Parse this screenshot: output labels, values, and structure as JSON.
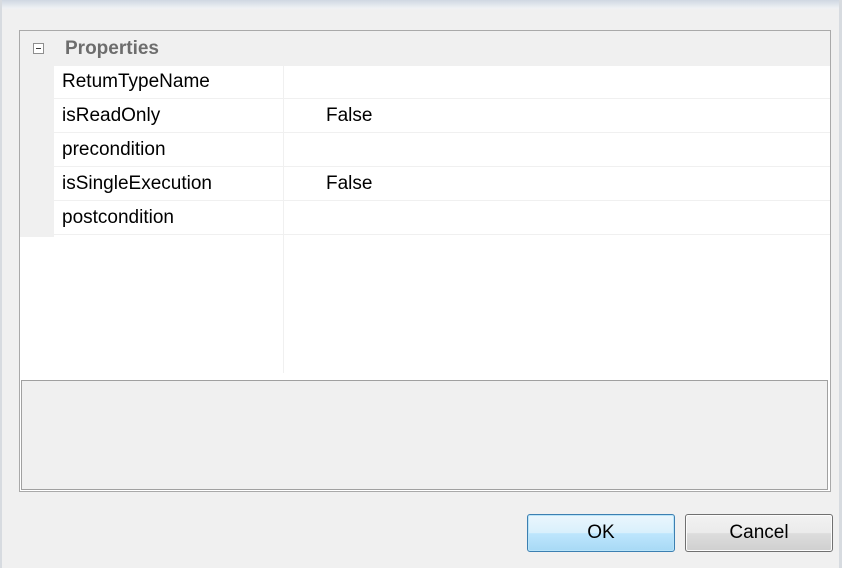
{
  "property_grid": {
    "category": {
      "label": "Properties",
      "expander_icon": "collapse-minus-icon"
    },
    "rows": [
      {
        "name": "RetumTypeName",
        "value": ""
      },
      {
        "name": "isReadOnly",
        "value": "False"
      },
      {
        "name": "precondition",
        "value": ""
      },
      {
        "name": "isSingleExecution",
        "value": "False"
      },
      {
        "name": "postcondition",
        "value": ""
      }
    ],
    "help_text": ""
  },
  "buttons": {
    "ok_label": "OK",
    "cancel_label": "Cancel"
  },
  "colors": {
    "window_background": "#f0f0f0",
    "grid_background": "#ffffff",
    "category_text": "#6d6d6d",
    "ok_border": "#3c7fb1"
  }
}
